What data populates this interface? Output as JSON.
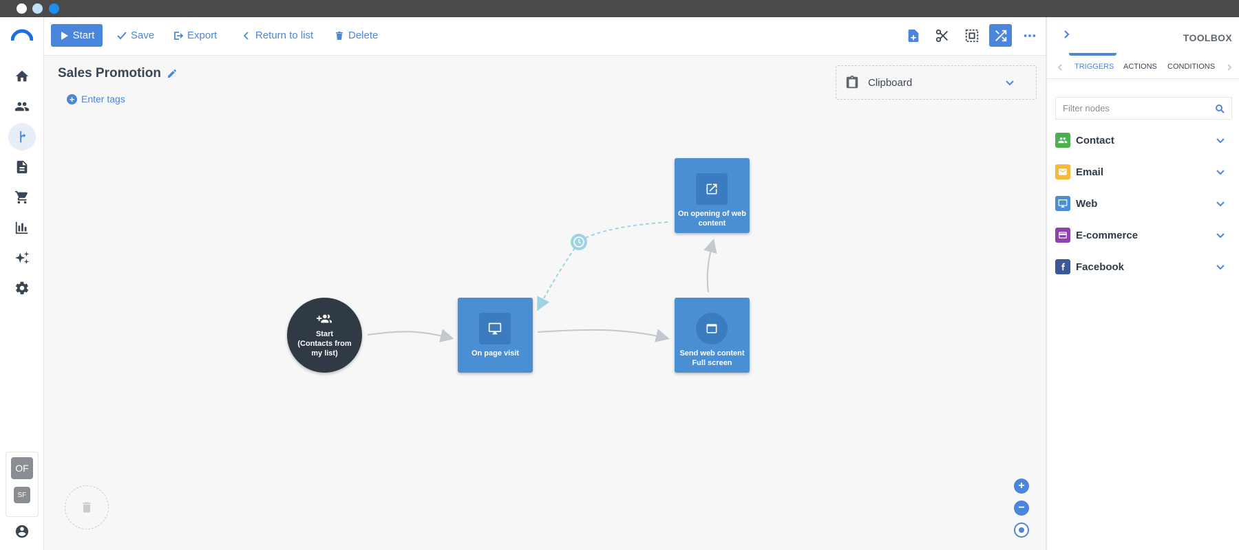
{
  "window": {
    "dot_colors": [
      "#ffffff",
      "#bfe0f7",
      "#1c8ef0"
    ]
  },
  "toolbar": {
    "start_label": "Start",
    "save_label": "Save",
    "export_label": "Export",
    "return_label": "Return to list",
    "delete_label": "Delete",
    "right_icons": [
      "add-node-icon",
      "scissors-icon",
      "select-area-icon",
      "auto-layout-icon",
      "more-icon"
    ]
  },
  "sidebar": {
    "items": [
      "home-icon",
      "contacts-icon",
      "workflow-icon",
      "document-icon",
      "cart-icon",
      "chart-icon",
      "sparkle-icon",
      "gear-icon"
    ],
    "active_item": "workflow-icon",
    "badges": [
      "OF",
      "SF"
    ],
    "bottom_icon": "account-icon"
  },
  "canvas": {
    "title": "Sales Promotion",
    "tags_label": "Enter tags",
    "clipboard_label": "Clipboard",
    "nodes": {
      "start": {
        "line1": "Start",
        "line2": "(Contacts from my list)"
      },
      "page_visit": "On page visit",
      "send_web": "Send web content Full screen",
      "open_web": "On opening of web content"
    },
    "zoom_in": "+",
    "zoom_out": "−"
  },
  "toolbox": {
    "title": "TOOLBOX",
    "tabs": [
      "TRIGGERS",
      "ACTIONS",
      "CONDITIONS"
    ],
    "active_tab": "TRIGGERS",
    "filter_placeholder": "Filter nodes",
    "categories": [
      {
        "label": "Contact",
        "color": "#4caf50"
      },
      {
        "label": "Email",
        "color": "#f6b93b"
      },
      {
        "label": "Web",
        "color": "#4a8fd4"
      },
      {
        "label": "E-commerce",
        "color": "#8e44ad"
      },
      {
        "label": "Facebook",
        "color": "#3b5998"
      }
    ]
  },
  "colors": {
    "accent": "#4a86dc",
    "node": "#4a8fd4",
    "start_node": "#2f3a45"
  }
}
